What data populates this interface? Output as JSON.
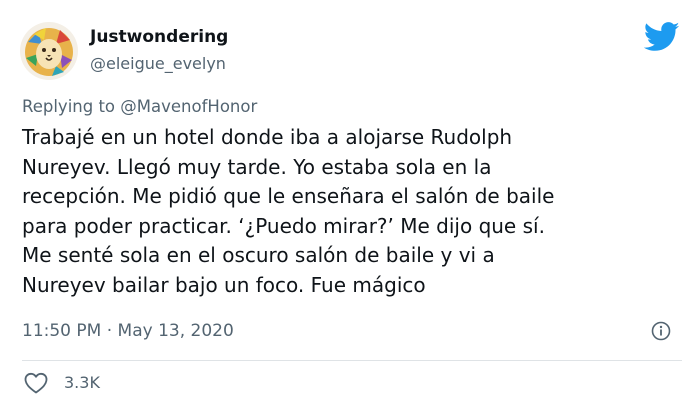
{
  "author": {
    "display_name": "Justwondering",
    "handle": "@eleigue_evelyn",
    "avatar_icon": "lion-avatar"
  },
  "brand": {
    "logo_icon": "twitter-bird-icon",
    "color": "#1d9bf0"
  },
  "reply": {
    "prefix": "Replying to",
    "mention": "@MavenofHonor"
  },
  "tweet": {
    "lines": [
      "Trabajé en un hotel donde iba a alojarse Rudolph",
      "Nureyev. Llegó muy tarde. Yo estaba sola en la",
      "recepción. Me pidió que le enseñara el salón de baile",
      "para poder practicar. ‘¿Puedo mirar?’ Me dijo que sí.",
      "Me senté sola en el oscuro salón de baile y vi a",
      "Nureyev bailar bajo un foco. Fue mágico"
    ]
  },
  "meta": {
    "time": "11:50 PM",
    "separator": "·",
    "date": "May 13, 2020",
    "info_icon": "info-icon"
  },
  "actions": {
    "like_icon": "heart-icon",
    "like_count": "3.3K"
  }
}
